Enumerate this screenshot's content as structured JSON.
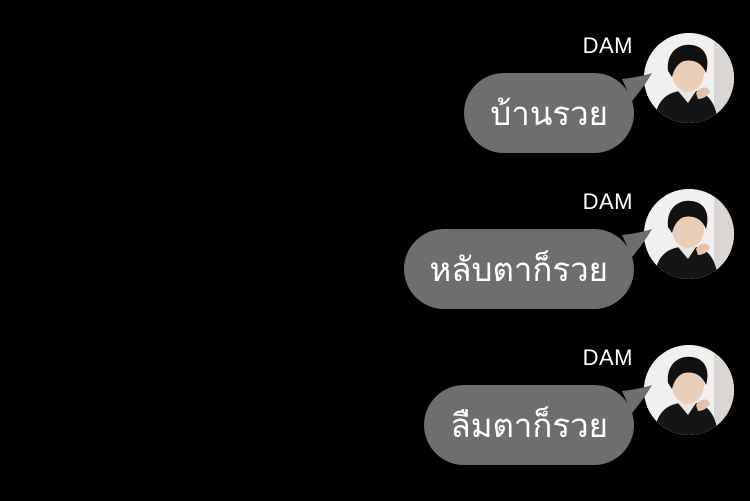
{
  "messages": [
    {
      "sender": "DAM",
      "text": "บ้านรวย",
      "avatar": "profile-photo"
    },
    {
      "sender": "DAM",
      "text": "หลับตาก็รวย",
      "avatar": "profile-photo"
    },
    {
      "sender": "DAM",
      "text": "ลืมตาก็รวย",
      "avatar": "profile-photo"
    }
  ],
  "colors": {
    "background": "#000000",
    "bubble": "#6e6e6e",
    "text": "#ffffff"
  }
}
